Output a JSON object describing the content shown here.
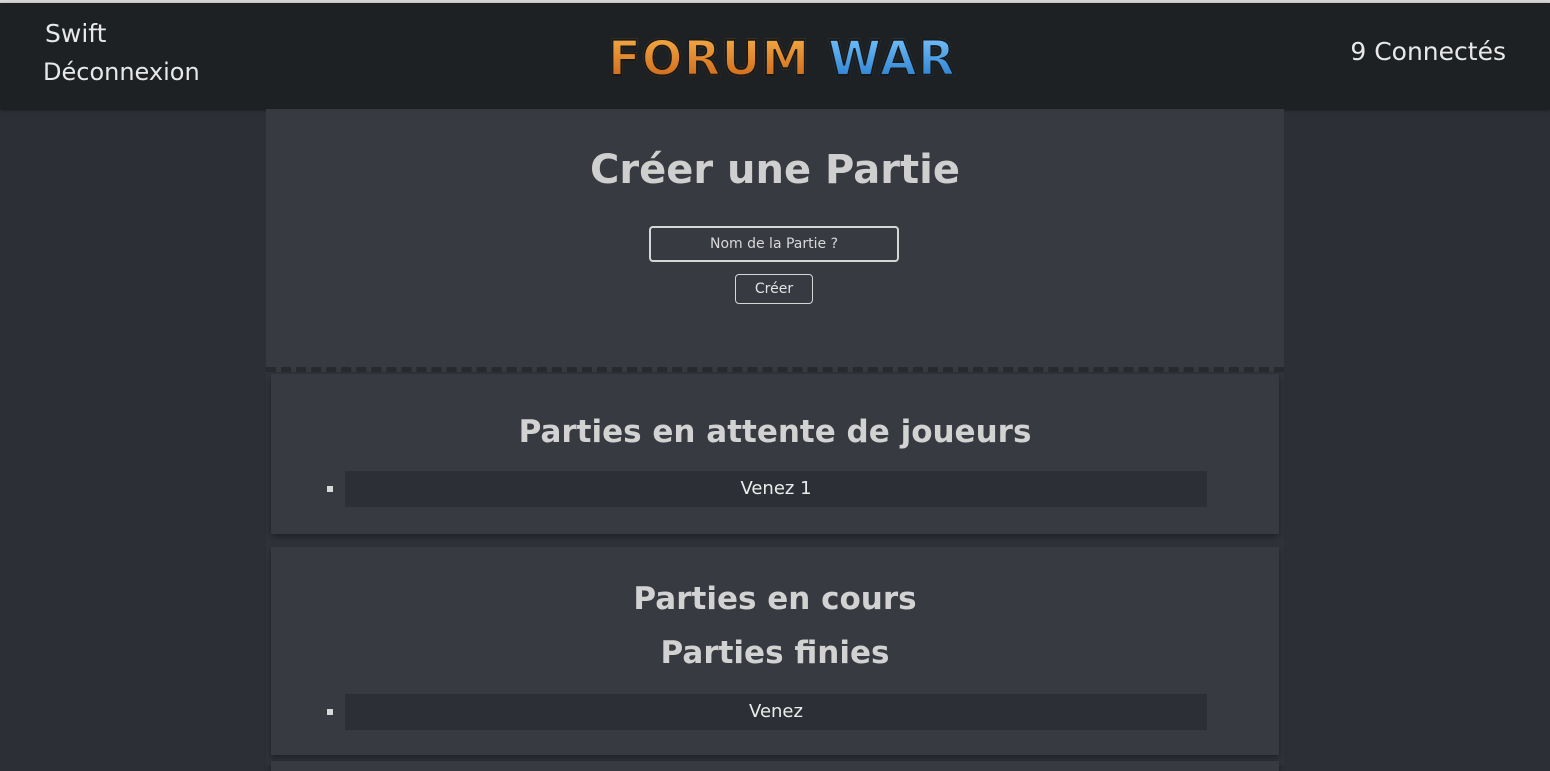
{
  "header": {
    "username": "Swift",
    "logout_label": "Déconnexion",
    "logo": {
      "word1": "FORUM",
      "word2": "WAR"
    },
    "online_count": "9 Connectés"
  },
  "create": {
    "title": "Créer une Partie",
    "input_placeholder": "Nom de la Partie ?",
    "button_label": "Créer"
  },
  "waiting": {
    "title": "Parties en attente de joueurs",
    "games": [
      "Venez 1"
    ]
  },
  "active": {
    "title": "Parties en cours",
    "games": []
  },
  "finished": {
    "title": "Parties finies",
    "games": [
      "Venez"
    ]
  },
  "colors": {
    "background": "#2c2f36",
    "header": "#1e2124",
    "panel": "#373a40",
    "logo_orange": "#e88a2a",
    "logo_blue": "#4aa3e8"
  }
}
